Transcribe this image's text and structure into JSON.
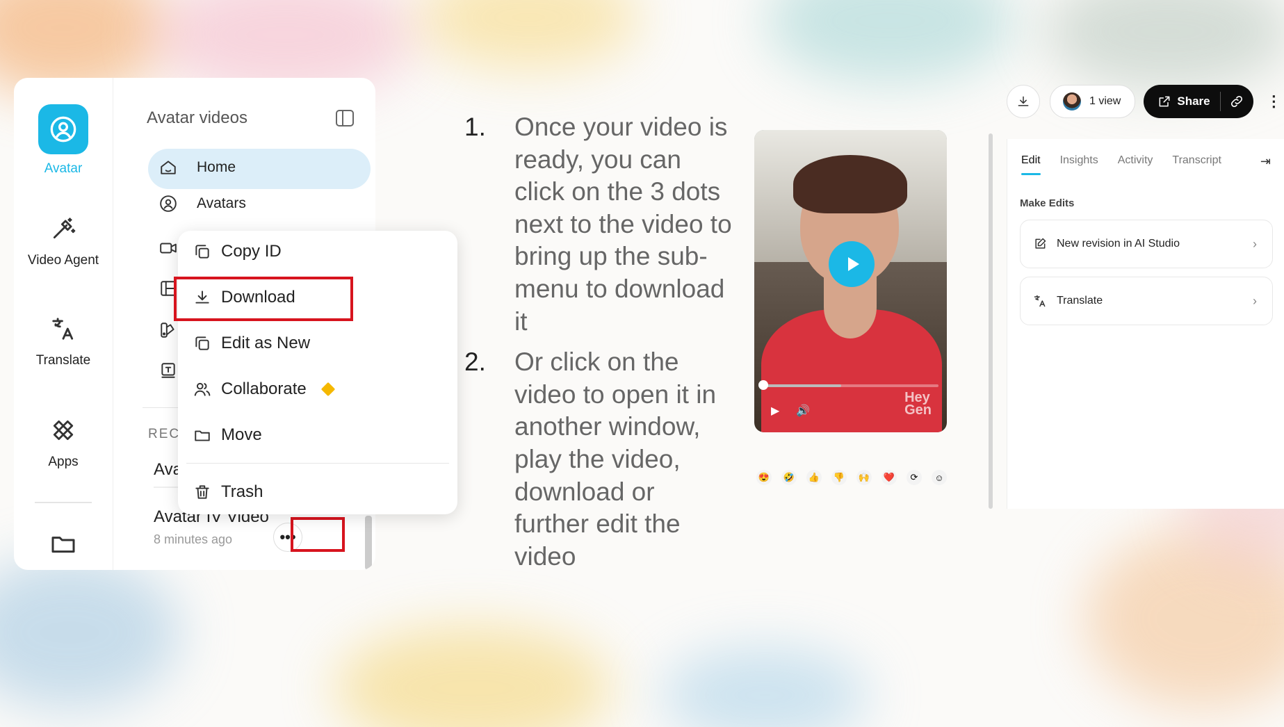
{
  "rail": {
    "avatar_label": "Avatar",
    "video_agent_label": "Video Agent",
    "translate_label": "Translate",
    "apps_label": "Apps"
  },
  "panel": {
    "title": "Avatar videos",
    "home_label": "Home",
    "avatars_label": "Avatars",
    "recent_label": "RECE",
    "recent_rows": [
      {
        "title": "Avat"
      },
      {
        "title": "Avatar IV Video",
        "time": "8 minutes ago"
      }
    ],
    "more_label": "•••"
  },
  "context_menu": {
    "items": [
      {
        "label": "Copy ID"
      },
      {
        "label": "Download"
      },
      {
        "label": "Edit as New"
      },
      {
        "label": "Collaborate"
      },
      {
        "label": "Move"
      },
      {
        "label": "Trash"
      }
    ]
  },
  "instructions": [
    {
      "num": "1.",
      "text": "Once your video is ready, you can click on the 3 dots next to the video to bring up the sub-menu to download it"
    },
    {
      "num": "2.",
      "text": "Or click on the video to open it in another window, play the video, download or further edit the video"
    }
  ],
  "video": {
    "watermark": "Hey\nGen",
    "progress": 0.45,
    "reactions": [
      "😍",
      "🤣",
      "👍",
      "👎",
      "🙌",
      "❤️",
      "⟳",
      "☺"
    ]
  },
  "toolbar": {
    "views_label": "1 view",
    "share_label": "Share"
  },
  "side_panel": {
    "tabs": [
      "Edit",
      "Insights",
      "Activity",
      "Transcript"
    ],
    "section_title": "Make Edits",
    "actions": [
      {
        "label": "New revision in AI Studio"
      },
      {
        "label": "Translate"
      }
    ]
  },
  "colors": {
    "accent": "#1bb8e6",
    "highlight": "#d7141e",
    "nav_active_bg": "#dceef9"
  }
}
